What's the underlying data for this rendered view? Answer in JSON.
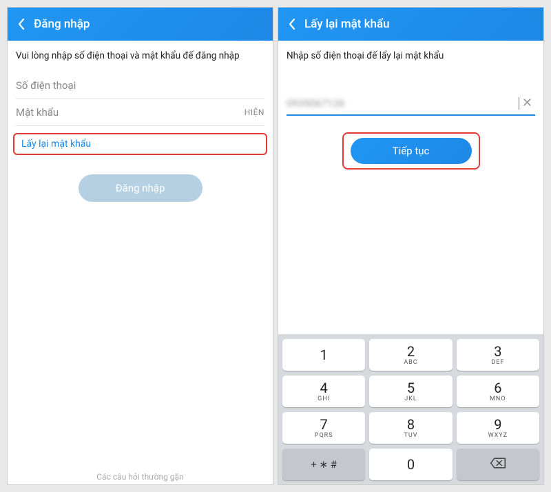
{
  "left": {
    "header_title": "Đăng nhập",
    "instruction": "Vui lòng nhập số điện thoại và mật khẩu đế đăng nhập",
    "phone_placeholder": "Số điện thoại",
    "password_placeholder": "Mật khẩu",
    "show_toggle": "HIỆN",
    "forgot_text": "Lấy lại mật khẩu",
    "login_button": "Đăng nhập",
    "faq_text": "Các câu hỏi thường gặn"
  },
  "right": {
    "header_title": "Lấy lại mật khẩu",
    "instruction": "Nhập số điện thoại đế lẩy lại mật khẩu",
    "phone_value_masked": "0935067126",
    "clear_symbol": "✕",
    "continue_button": "Tiếp tục"
  },
  "keypad": {
    "keys": [
      [
        {
          "n": "1",
          "l": ""
        },
        {
          "n": "2",
          "l": "ABC"
        },
        {
          "n": "3",
          "l": "DEF"
        }
      ],
      [
        {
          "n": "4",
          "l": "GHI"
        },
        {
          "n": "5",
          "l": "JKL"
        },
        {
          "n": "6",
          "l": "MNO"
        }
      ],
      [
        {
          "n": "7",
          "l": "PQRS"
        },
        {
          "n": "8",
          "l": "TUV"
        },
        {
          "n": "9",
          "l": "WXYZ"
        }
      ]
    ],
    "bottom_left": "+ ∗ #",
    "bottom_mid": "0"
  }
}
